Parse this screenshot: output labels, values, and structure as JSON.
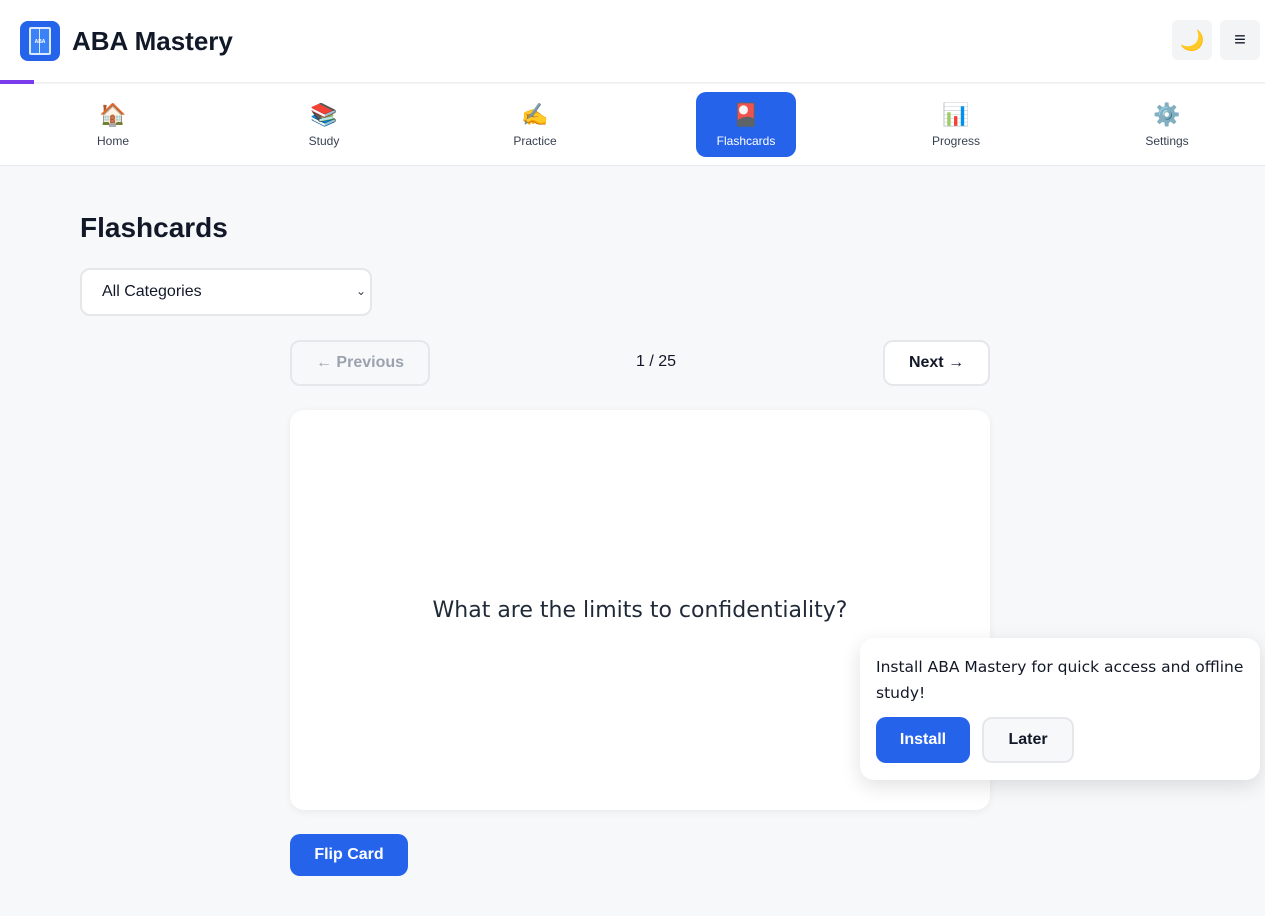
{
  "app": {
    "title": "ABA Mastery",
    "logo_text": "ABA",
    "theme_toggle_icon": "🌙",
    "menu_icon": "≡"
  },
  "nav": {
    "items": [
      {
        "label": "Home",
        "icon": "🏠",
        "active": false
      },
      {
        "label": "Study",
        "icon": "📚",
        "active": false
      },
      {
        "label": "Practice",
        "icon": "✍️",
        "active": false
      },
      {
        "label": "Flashcards",
        "icon": "🎴",
        "active": true
      },
      {
        "label": "Progress",
        "icon": "📊",
        "active": false
      },
      {
        "label": "Settings",
        "icon": "⚙️",
        "active": false
      }
    ]
  },
  "main": {
    "page_title": "Flashcards",
    "category_select": {
      "selected": "All Categories"
    },
    "prev_label": "← Previous",
    "next_label": "Next →",
    "counter": "1 / 25",
    "card": {
      "question": "What are the limits to confidentiality?"
    },
    "flip_label": "Flip Card"
  },
  "install_prompt": {
    "message": "Install ABA Mastery for quick access and offline study!",
    "install_label": "Install",
    "later_label": "Later"
  },
  "colors": {
    "accent": "#2563eb",
    "background": "#f7f8fa",
    "progress_strip": "#7c3aed"
  }
}
